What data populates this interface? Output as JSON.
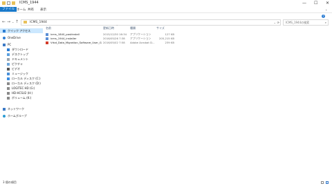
{
  "window": {
    "title": "ICMS_1944"
  },
  "ribbon": {
    "tabs": [
      "ファイル",
      "ホーム",
      "共有",
      "表示"
    ]
  },
  "address": {
    "path": "ICMS_1944",
    "search_placeholder": "ICMS_1944の検索"
  },
  "sidebar": {
    "items": [
      {
        "label": "クイック アクセス",
        "icon": "star-icon"
      },
      {
        "label": "OneDrive",
        "icon": "cloud-icon"
      },
      {
        "label": "PC",
        "icon": "pc-icon"
      },
      {
        "label": "ダウンロード",
        "icon": "download-icon"
      },
      {
        "label": "デスクトップ",
        "icon": "desktop-icon"
      },
      {
        "label": "ドキュメント",
        "icon": "documents-icon"
      },
      {
        "label": "ピクチャ",
        "icon": "pictures-icon"
      },
      {
        "label": "ビデオ",
        "icon": "video-icon"
      },
      {
        "label": "ミュージック",
        "icon": "music-icon"
      },
      {
        "label": "ローカル ディスク (C:)",
        "icon": "drive-icon"
      },
      {
        "label": "ローカル ディスク (D:)",
        "icon": "drive-icon"
      },
      {
        "label": "LOGITEC HD (G:)",
        "icon": "drive-icon"
      },
      {
        "label": "HD-HCSU2 (H:)",
        "icon": "drive-icon"
      },
      {
        "label": "ボリューム (K:)",
        "icon": "drive-icon"
      },
      {
        "label": "ネットワーク",
        "icon": "network-icon"
      },
      {
        "label": "ホームグループ",
        "icon": "homegroup-icon"
      }
    ]
  },
  "columns": [
    "名前",
    "更新日時",
    "種類",
    "サイズ"
  ],
  "files": [
    {
      "name": "icms_1840_postinstall",
      "date": "2015/12/30 16:34",
      "type": "アプリケーション",
      "size": "127 KB"
    },
    {
      "name": "icms_1944_installer",
      "date": "2016/05/26 7:38",
      "type": "アプリケーション",
      "size": "205,215 KB"
    },
    {
      "name": "Vrbd_Data_Migration_Software_User_Gui...",
      "date": "2016/05/02 7:58",
      "type": "Adobe Acrobat D...",
      "size": "239 KB"
    }
  ],
  "status": {
    "count": "3 個の項目"
  },
  "colors": {
    "accent": "#1979ca",
    "folder": "#e8c15a",
    "selection": "#cce8ff"
  }
}
